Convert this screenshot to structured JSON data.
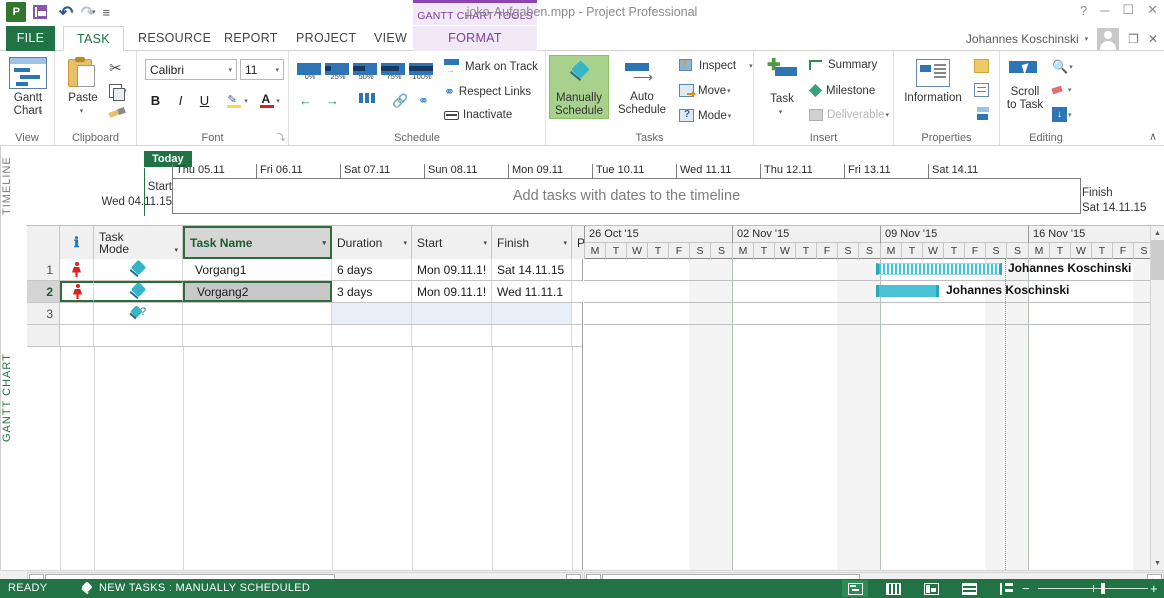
{
  "window": {
    "title": "joko-Aufgaben.mpp - Project Professional",
    "contextual_tab_group": "GANTT CHART TOOLS",
    "contextual_tab": "FORMAT",
    "help": "?",
    "minimize": "─",
    "restore": "☐",
    "close": "✕",
    "ribbon_display": "❐",
    "window_close": "✕"
  },
  "quick_access": {
    "logo": "P",
    "save": "save-icon",
    "undo": "↶",
    "redo": "↷",
    "customize": "≡"
  },
  "account": {
    "name": "Johannes Koschinski",
    "caret": "▾"
  },
  "tabs": [
    {
      "label": "FILE"
    },
    {
      "label": "TASK"
    },
    {
      "label": "RESOURCE"
    },
    {
      "label": "REPORT"
    },
    {
      "label": "PROJECT"
    },
    {
      "label": "VIEW"
    },
    {
      "label": "FORMAT"
    }
  ],
  "ribbon": {
    "groups": [
      {
        "name": "View"
      },
      {
        "name": "Clipboard"
      },
      {
        "name": "Font"
      },
      {
        "name": "Schedule"
      },
      {
        "name": "Tasks"
      },
      {
        "name": "Insert"
      },
      {
        "name": "Properties"
      },
      {
        "name": "Editing"
      }
    ],
    "view": {
      "gantt_line1": "Gantt",
      "gantt_line2": "Chart",
      "caret": "▾"
    },
    "clipboard": {
      "paste_line1": "Paste",
      "paste_caret": "▾",
      "cut": "✂",
      "copy": "copy-icon",
      "format_painter": "format-painter-icon"
    },
    "font": {
      "family": "Calibri",
      "size": "11",
      "bold": "B",
      "italic": "I",
      "underline": "U",
      "highlight": "highlight-icon",
      "color": "A",
      "caret": "▾",
      "dialog_launcher": "⤵"
    },
    "schedule": {
      "percents": [
        "0%",
        "25%",
        "50%",
        "75%",
        "100%"
      ],
      "outdent": "←",
      "indent": "→",
      "unlink_split": "split-task-icon",
      "link": "link-icon",
      "unlink": "unlink-icon",
      "mark_on_track": "Mark on Track",
      "respect_links": "Respect Links",
      "inactivate": "Inactivate",
      "caret": "▾"
    },
    "tasks": {
      "manually_line1": "Manually",
      "manually_line2": "Schedule",
      "auto_line1": "Auto",
      "auto_line2": "Schedule",
      "inspect": "Inspect",
      "move": "Move",
      "mode": "Mode",
      "caret": "▾"
    },
    "insert": {
      "task": "Task",
      "task_caret": "▾",
      "summary": "Summary",
      "milestone": "Milestone",
      "deliverable": "Deliverable",
      "caret": "▾"
    },
    "properties": {
      "information": "Information",
      "notes": "notes-icon",
      "details": "details-icon",
      "add_to_timeline": "add-to-timeline-icon"
    },
    "editing": {
      "scroll_line1": "Scroll",
      "scroll_line2": "to Task",
      "find": "find-icon",
      "clear": "clear-icon",
      "fill_down": "↓",
      "caret": "▾"
    },
    "collapse": "∧"
  },
  "timeline": {
    "side_label": "TIMELINE",
    "today_badge": "Today",
    "start_label": "Start",
    "start_date": "Wed 04.11.15",
    "finish_label": "Finish",
    "finish_date": "Sat 14.11.15",
    "placeholder": "Add tasks with dates to the timeline",
    "ticks": [
      "Thu 05.11",
      "Fri 06.11",
      "Sat 07.11",
      "Sun 08.11",
      "Mon 09.11",
      "Tue 10.11",
      "Wed 11.11",
      "Thu 12.11",
      "Fri 13.11",
      "Sat 14.11"
    ]
  },
  "gantt_view": {
    "side_label": "GANTT CHART",
    "columns": [
      {
        "key": "info",
        "label": "ℹ"
      },
      {
        "key": "mode",
        "label1": "Task",
        "label2": "Mode"
      },
      {
        "key": "name",
        "label": "Task Name"
      },
      {
        "key": "duration",
        "label": "Duration"
      },
      {
        "key": "start",
        "label": "Start"
      },
      {
        "key": "finish",
        "label": "Finish"
      },
      {
        "key": "pred",
        "label": "Prede"
      }
    ],
    "rows": [
      {
        "num": "1",
        "indicator": "overallocated-resource-icon",
        "mode": "manually-scheduled-pin-icon",
        "name": "Vorgang1",
        "duration": "6 days",
        "start": "Mon 09.11.1!",
        "finish": "Sat 14.11.15",
        "pred": ""
      },
      {
        "num": "2",
        "indicator": "overallocated-resource-icon",
        "mode": "manually-scheduled-pin-icon",
        "name": "Vorgang2",
        "duration": "3 days",
        "start": "Mon 09.11.1!",
        "finish": "Wed 11.11.1",
        "pred": ""
      },
      {
        "num": "3",
        "indicator": "",
        "mode": "new-task-pin-icon",
        "name": "",
        "duration": "",
        "start": "",
        "finish": "",
        "pred": ""
      }
    ],
    "timescale": {
      "weeks": [
        "26 Oct '15",
        "02 Nov '15",
        "09 Nov '15",
        "16 Nov '15"
      ],
      "days": [
        "M",
        "T",
        "W",
        "T",
        "F",
        "S",
        "S"
      ]
    },
    "bars": [
      {
        "label": "Johannes Koschinski",
        "style": "manual"
      },
      {
        "label": "Johannes Koschinski",
        "style": "solid"
      }
    ]
  },
  "status_bar": {
    "ready": "READY",
    "new_tasks": "NEW TASKS : MANUALLY SCHEDULED",
    "views": [
      "gantt-chart-view-icon",
      "task-usage-view-icon",
      "team-planner-view-icon",
      "resource-sheet-view-icon",
      "report-view-icon"
    ],
    "zoom_out": "−",
    "zoom_in": "+"
  },
  "colors": {
    "accent_green": "#217346",
    "contextual_purple": "#8a46b0",
    "bar_cyan": "#4bc2d4",
    "indicator_red": "#e02020"
  }
}
